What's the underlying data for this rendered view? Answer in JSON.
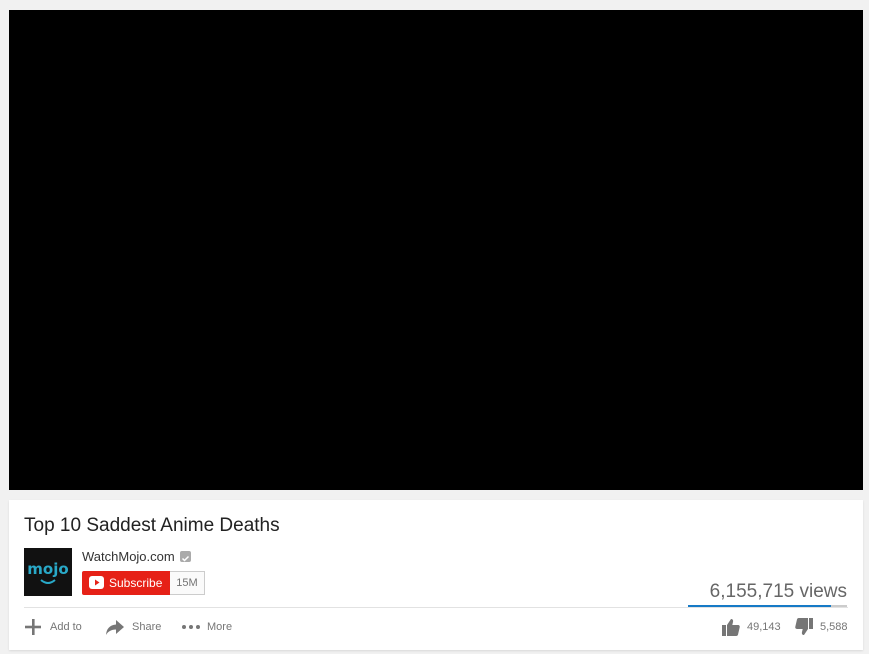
{
  "video": {
    "title": "Top 10 Saddest Anime Deaths",
    "views": "6,155,715 views",
    "like_ratio": 0.898
  },
  "channel": {
    "name": "WatchMojo.com",
    "avatar_text": "mojo",
    "verified_icon": "verified-check-icon"
  },
  "subscribe": {
    "label": "Subscribe",
    "count": "15M"
  },
  "actions": {
    "add_to": "Add to",
    "share": "Share",
    "more": "More"
  },
  "ratings": {
    "likes": "49,143",
    "dislikes": "5,588"
  },
  "colors": {
    "subscribe_red": "#e62117",
    "like_bar_blue": "#167ac6",
    "avatar_teal": "#29a9c8"
  },
  "icons": [
    "plus-icon",
    "share-arrow-icon",
    "more-dots-icon",
    "thumbs-up-icon",
    "thumbs-down-icon",
    "youtube-play-icon"
  ]
}
